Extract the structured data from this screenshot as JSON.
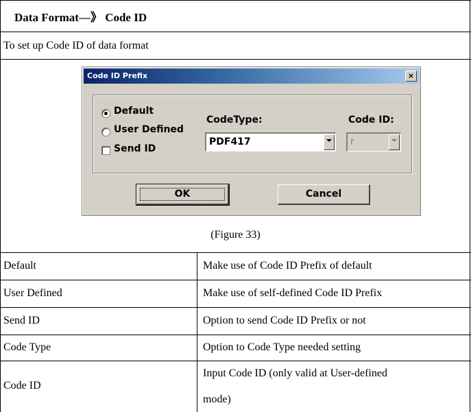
{
  "section": {
    "title": "Data Format—》 Code ID",
    "subtitle": "To set up Code ID of data format",
    "caption": "(Figure 33)"
  },
  "dialog": {
    "title": "Code ID Prefix",
    "close_glyph": "×",
    "options": {
      "default_label": "Default",
      "user_defined_label": "User Defined",
      "send_id_label": "Send ID",
      "selected": "Default",
      "send_id_checked": false
    },
    "code_type_label": "CodeType:",
    "code_type_value": "PDF417",
    "code_id_label": "Code ID:",
    "code_id_value": "r",
    "ok_label": "OK",
    "cancel_label": "Cancel"
  },
  "table": {
    "rows": [
      {
        "name": "Default",
        "desc": "Make use of Code ID Prefix of default"
      },
      {
        "name": "User Defined",
        "desc": "Make use of self-defined Code ID Prefix"
      },
      {
        "name": "Send ID",
        "desc": "Option to send Code ID Prefix or not"
      },
      {
        "name": "Code Type",
        "desc": "Option to Code Type needed setting"
      },
      {
        "name": "Code ID",
        "desc_line1": "Input Code ID (only valid at User-defined",
        "desc_line2": "mode)"
      }
    ]
  }
}
